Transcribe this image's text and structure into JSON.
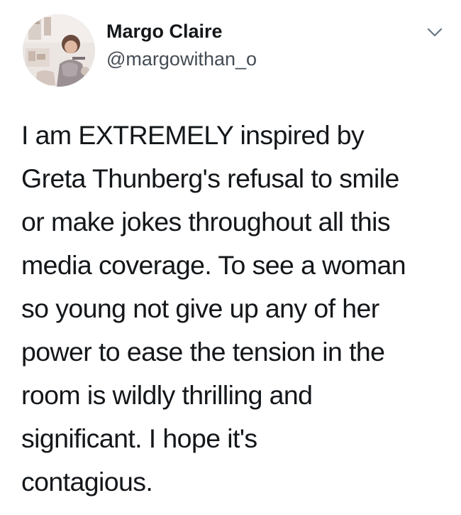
{
  "tweet": {
    "author": {
      "display_name": "Margo Claire",
      "handle": "@margowithan_o",
      "avatar_icon": "profile-photo"
    },
    "menu_icon": "chevron-down-icon",
    "text_lines": [
      "I am EXTREMELY inspired by",
      "Greta Thunberg's refusal to smile",
      "or make jokes throughout all this",
      "media coverage. To see a woman",
      "so young not give up any of her",
      "power to ease the tension in the",
      "room is wildly thrilling and",
      "significant. I hope it's",
      "contagious."
    ]
  },
  "colors": {
    "text": "#14171a",
    "handle": "#444c54",
    "caret": "#657786",
    "background": "#ffffff"
  }
}
